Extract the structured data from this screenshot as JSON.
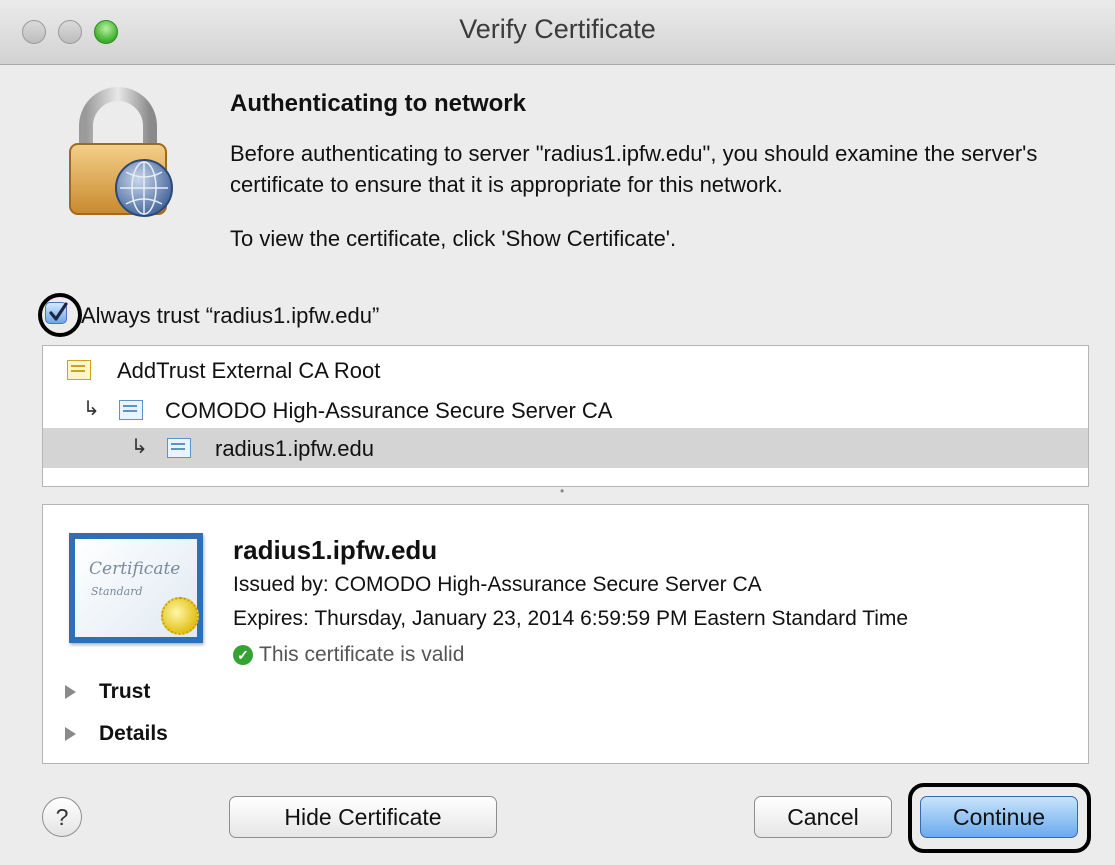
{
  "window": {
    "title": "Verify Certificate"
  },
  "message": {
    "heading": "Authenticating to network",
    "description": "Before authenticating to server \"radius1.ipfw.edu\", you should examine the server's certificate to ensure that it is appropriate for this network.",
    "hint": "To view the certificate, click 'Show Certificate'."
  },
  "trust": {
    "label": "Always trust “radius1.ipfw.edu”",
    "checked": true
  },
  "chain": [
    {
      "name": "AddTrust External CA Root",
      "icon": "certificate-root-icon"
    },
    {
      "name": "COMODO High-Assurance Secure Server CA",
      "icon": "certificate-intermediate-icon"
    },
    {
      "name": "radius1.ipfw.edu",
      "icon": "certificate-leaf-icon",
      "selected": true
    }
  ],
  "certificate": {
    "name": "radius1.ipfw.edu",
    "issued_by": "Issued by: COMODO High-Assurance Secure Server CA",
    "expires": "Expires: Thursday, January 23, 2014 6:59:59 PM Eastern Standard Time",
    "status": "This certificate is valid",
    "status_color": "#35a333",
    "image_text_1": "Certificate",
    "image_text_2": "Standard"
  },
  "sections": {
    "trust": "Trust",
    "details": "Details"
  },
  "buttons": {
    "help": "?",
    "hide_certificate": "Hide Certificate",
    "cancel": "Cancel",
    "continue": "Continue"
  },
  "colors": {
    "accent": "#6aaaee",
    "selection": "#d4d4d4"
  }
}
